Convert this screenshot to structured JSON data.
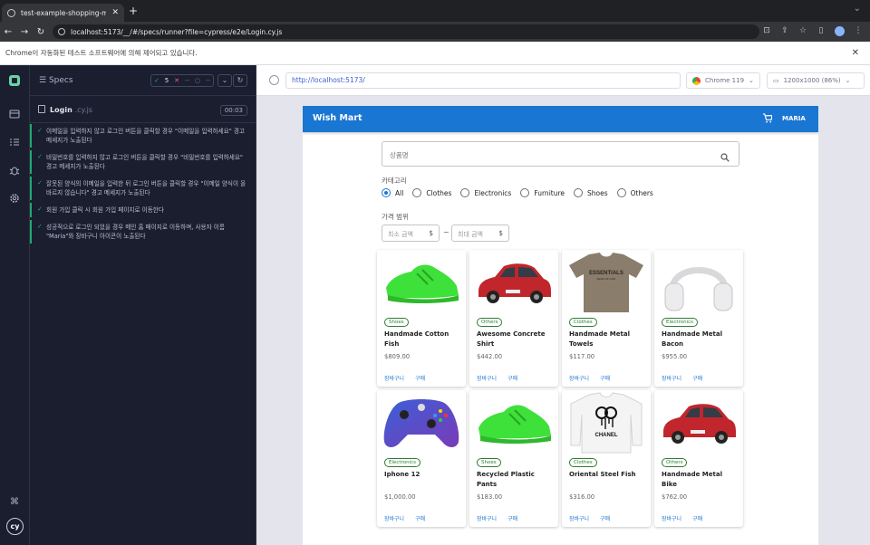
{
  "browser": {
    "tab_title": "test-example-shopping-mall",
    "new_tab": "+",
    "url": "localhost:5173/__/#/specs/runner?file=cypress/e2e/Login.cy.js",
    "infobar_text": "Chrome이 자동화된 테스트 소프트웨어에 의해 제어되고 있습니다."
  },
  "runner": {
    "specs_label": "Specs",
    "stats": {
      "passed": "5",
      "failed": "--",
      "pending": "--"
    },
    "spec_name": "Login",
    "spec_ext": ".cy.js",
    "duration": "00:03",
    "tests": [
      "이메일을 입력하지 않고 로그인 버튼을 클릭할 경우 \"이메일을 입력하세요\" 경고 메세지가 노출된다",
      "비밀번호를 입력하지 않고 로그인 버튼을 클릭할 경우 \"비밀번호를 입력하세요\" 경고 메세지가 노출된다",
      "잘못된 양식의 이메일을 입력한 뒤 로그인 버튼을 클릭할 경우 \"이메일 양식이 올바르지 않습니다\" 경고 메세지가 노출된다",
      "회원 가입 클릭 시 회원 가입 페이지로 이동한다",
      "성공적으로 로그인 되었을 경우 메인 홈 페이지로 이동하며, 사용자 이름 \"Maria\"와 장바구니 아이콘이 노출된다"
    ],
    "aut_url": "http://localhost:5173/",
    "browser_name": "Chrome 119",
    "viewport": "1200x1000 (86%)"
  },
  "app": {
    "brand": "Wish Mart",
    "user": "MARIA",
    "search_placeholder": "상품명",
    "category_label": "카테고리",
    "categories": [
      "All",
      "Clothes",
      "Electronics",
      "Furniture",
      "Shoes",
      "Others"
    ],
    "selected_category": "All",
    "price_label": "가격 범위",
    "min_placeholder": "최소 금액",
    "max_placeholder": "최대 금액",
    "currency": "$",
    "range_sep": "~",
    "cart_label": "장바구니",
    "buy_label": "구매",
    "products": [
      {
        "category": "Shoes",
        "name": "Handmade Cotton Fish",
        "price": "$809.00",
        "image": "green-sneaker"
      },
      {
        "category": "Others",
        "name": "Awesome Concrete Shirt",
        "price": "$442.00",
        "image": "red-car"
      },
      {
        "category": "Clothes",
        "name": "Handmade Metal Towels",
        "price": "$117.00",
        "image": "essentials-tshirt"
      },
      {
        "category": "Electronics",
        "name": "Handmade Metal Bacon",
        "price": "$955.00",
        "image": "headphones"
      },
      {
        "category": "Electronics",
        "name": "Iphone 12",
        "price": "$1,000.00",
        "image": "game-controller"
      },
      {
        "category": "Shoes",
        "name": "Recycled Plastic Pants",
        "price": "$183.00",
        "image": "green-sneaker"
      },
      {
        "category": "Clothes",
        "name": "Oriental Steel Fish",
        "price": "$316.00",
        "image": "chanel-sweatshirt"
      },
      {
        "category": "Others",
        "name": "Handmade Metal Bike",
        "price": "$762.00",
        "image": "red-car"
      }
    ]
  },
  "colors": {
    "primary": "#1976d2",
    "pass": "#1fa971",
    "chip": "#2e7d32"
  }
}
